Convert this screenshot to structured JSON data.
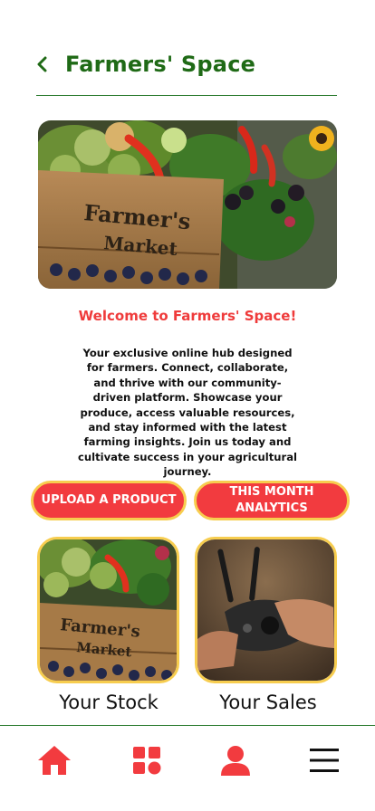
{
  "header": {
    "title": "Farmers' Space"
  },
  "welcome": {
    "heading": "Welcome to Farmers' Space!"
  },
  "intro": {
    "text": "Your exclusive online hub designed for farmers. Connect, collaborate, and thrive with our community-driven platform. Showcase your produce, access valuable resources, and stay informed with the latest farming insights. Join us today and cultivate success in your agricultural journey."
  },
  "hero": {
    "crate_line1": "Farmer's",
    "crate_line2": "Market"
  },
  "actions": {
    "upload_label": "UPLOAD A PRODUCT",
    "analytics_line1": "THIS MONTH",
    "analytics_line2": "ANALYTICS"
  },
  "cards": {
    "stock": {
      "label": "Your Stock",
      "crate_line1": "Farmer's",
      "crate_line2": "Market"
    },
    "sales": {
      "label": "Your Sales"
    }
  },
  "nav": {
    "items": [
      {
        "icon": "home-icon"
      },
      {
        "icon": "grid-icon"
      },
      {
        "icon": "user-icon"
      },
      {
        "icon": "menu-icon"
      }
    ]
  },
  "colors": {
    "accent": "#f23b3f",
    "border": "#f7cd4f",
    "title": "#1f6a16",
    "rule": "#2e7d32"
  }
}
